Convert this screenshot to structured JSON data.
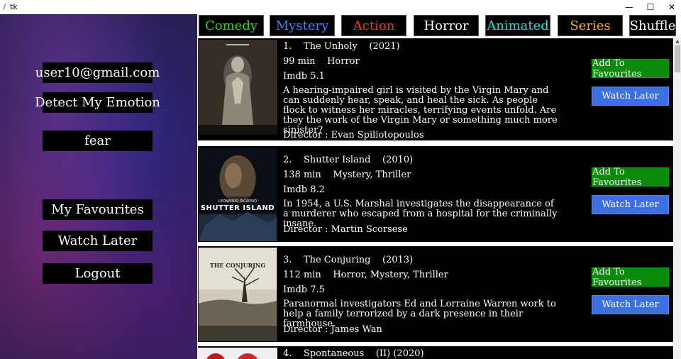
{
  "window": {
    "title": "tk",
    "minimize": "—",
    "maximize": "☐",
    "close": "✕"
  },
  "sidebar": {
    "email": "user10@gmail.com",
    "detect_label": "Detect My Emotion",
    "emotion": "fear",
    "favourites_label": "My Favourites",
    "watch_later_label": "Watch Later",
    "logout_label": "Logout"
  },
  "genres": [
    {
      "label": "Comedy",
      "color": "#22dd22"
    },
    {
      "label": "Mystery",
      "color": "#3a86ff"
    },
    {
      "label": "Action",
      "color": "#ff3311"
    },
    {
      "label": "Horror",
      "color": "#ffffff"
    },
    {
      "label": "Animated",
      "color": "#22dddd"
    },
    {
      "label": "Series",
      "color": "#ffaa22"
    },
    {
      "label": "Shuffle",
      "color": "#ffffff"
    }
  ],
  "movies": [
    {
      "index": "1.",
      "title": "The Unholy",
      "year": "(2021)",
      "runtime": "99 min",
      "genres": "Horror",
      "imdb": "Imdb 5.1",
      "description": "A hearing-impaired girl is visited by the Virgin Mary and can suddenly hear, speak, and heal the sick. As people flock to witness her miracles, terrifying events unfold. Are they the work of the Virgin Mary or something much more sinister?",
      "director": "Director : Evan Spiliotopoulos",
      "fav_label": "Add To Favourites",
      "later_label": "Watch Later"
    },
    {
      "index": "2.",
      "title": "Shutter Island",
      "year": "(2010)",
      "runtime": "138 min",
      "genres": "Mystery, Thriller",
      "imdb": "Imdb 8.2",
      "description": "In 1954, a U.S. Marshal investigates the disappearance of a murderer who escaped from a hospital for the criminally insane.",
      "director": "Director : Martin Scorsese",
      "poster_text": "SHUTTER ISLAND",
      "poster_actor": "LEONARDO DiCAPRIO",
      "fav_label": "Add To Favourites",
      "later_label": "Watch Later"
    },
    {
      "index": "3.",
      "title": "The Conjuring",
      "year": "(2013)",
      "runtime": "112 min",
      "genres": "Horror, Mystery, Thriller",
      "imdb": "Imdb 7.5",
      "description": "Paranormal investigators Ed and Lorraine Warren work to help a family terrorized by a dark presence in their farmhouse.",
      "director": "Director : James Wan",
      "poster_text": "THE CONJURING",
      "fav_label": "Add To Favourites",
      "later_label": "Watch Later"
    },
    {
      "index": "4.",
      "title": "Spontaneous",
      "year": "(II) (2020)"
    }
  ]
}
